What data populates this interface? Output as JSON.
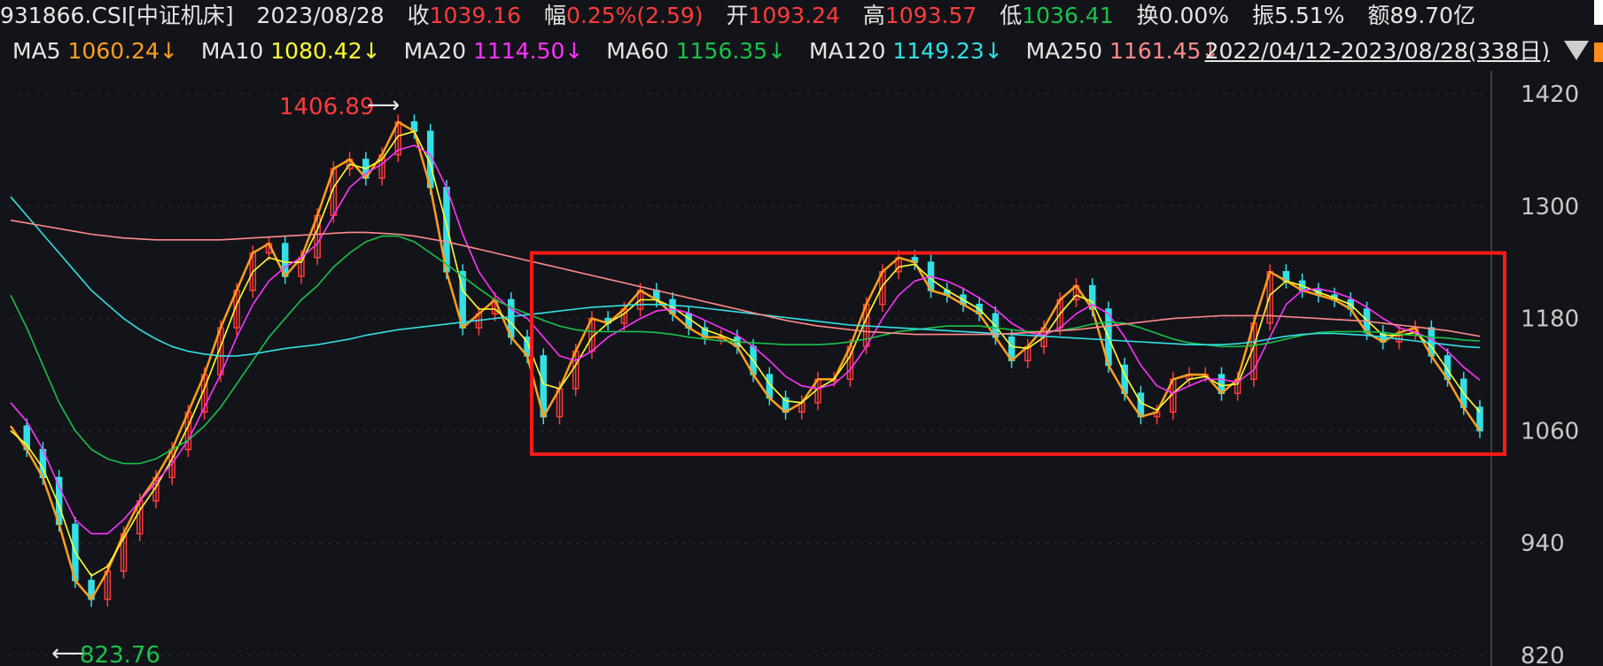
{
  "header": {
    "code": "931866.CSI[中证机床]",
    "date": "2023/08/28",
    "close_label": "收",
    "close_value": "1039.16",
    "change_label": "幅",
    "change_value": "0.25%(2.59)",
    "open_label": "开",
    "open_value": "1093.24",
    "high_label": "高",
    "high_value": "1093.57",
    "low_label": "低",
    "low_value": "1036.41",
    "turnover_label": "换",
    "turnover_value": "0.00%",
    "amplitude_label": "振",
    "amplitude_value": "5.51%",
    "amount_label": "额",
    "amount_value": "89.70亿"
  },
  "ma_row": {
    "ma5_label": "MA5",
    "ma5_value": "1060.24↓",
    "ma10_label": "MA10",
    "ma10_value": "1080.42↓",
    "ma20_label": "MA20",
    "ma20_value": "1114.50↓",
    "ma60_label": "MA60",
    "ma60_value": "1156.35↓",
    "ma120_label": "MA120",
    "ma120_value": "1149.23↓",
    "ma250_label": "MA250",
    "ma250_value": "1161.45↓",
    "range": "2022/04/12-2023/08/28(338日)"
  },
  "colors": {
    "background": "#131419",
    "ma5": "#ff9f1c",
    "ma10": "#ffff33",
    "ma20": "#ff33ff",
    "ma60": "#19c24b",
    "ma120": "#33e0e6",
    "ma250": "#ff8a8a",
    "up": "#ff3b3b",
    "down": "#33e0e6",
    "box": "#ff1a1a",
    "grid": "#2a2d35"
  },
  "chart_data": {
    "type": "line",
    "title": "",
    "xlabel": "",
    "ylabel": "",
    "ylim": [
      820,
      1440
    ],
    "yticks": [
      "1420",
      "1300",
      "1180",
      "1060",
      "940",
      "820"
    ],
    "annotations": {
      "high_label": "1406.89",
      "low_label": "823.76"
    },
    "highlight_box": {
      "y_top": 1250,
      "y_bottom": 1035
    },
    "series": [
      {
        "name": "MA5",
        "values": [
          1065,
          1040,
          1010,
          960,
          900,
          880,
          910,
          950,
          985,
          1010,
          1040,
          1080,
          1120,
          1170,
          1210,
          1250,
          1260,
          1225,
          1245,
          1290,
          1340,
          1350,
          1330,
          1355,
          1390,
          1380,
          1320,
          1230,
          1170,
          1185,
          1200,
          1160,
          1140,
          1075,
          1105,
          1145,
          1180,
          1175,
          1190,
          1210,
          1200,
          1185,
          1170,
          1160,
          1160,
          1150,
          1120,
          1095,
          1080,
          1090,
          1115,
          1115,
          1150,
          1195,
          1230,
          1245,
          1240,
          1210,
          1205,
          1195,
          1185,
          1160,
          1135,
          1150,
          1170,
          1200,
          1215,
          1190,
          1130,
          1100,
          1075,
          1080,
          1115,
          1120,
          1120,
          1100,
          1115,
          1175,
          1230,
          1220,
          1210,
          1205,
          1200,
          1190,
          1165,
          1155,
          1165,
          1170,
          1140,
          1115,
          1085,
          1060
        ]
      },
      {
        "name": "MA10",
        "values": [
          1060,
          1045,
          1020,
          980,
          930,
          905,
          915,
          945,
          975,
          1000,
          1030,
          1065,
          1105,
          1150,
          1195,
          1230,
          1245,
          1240,
          1240,
          1275,
          1320,
          1345,
          1340,
          1350,
          1375,
          1380,
          1345,
          1280,
          1210,
          1190,
          1190,
          1175,
          1155,
          1110,
          1105,
          1130,
          1160,
          1175,
          1185,
          1200,
          1200,
          1192,
          1180,
          1168,
          1162,
          1155,
          1135,
          1110,
          1092,
          1090,
          1105,
          1115,
          1140,
          1180,
          1215,
          1235,
          1238,
          1222,
          1210,
          1200,
          1190,
          1172,
          1150,
          1148,
          1160,
          1185,
          1205,
          1198,
          1160,
          1120,
          1090,
          1082,
          1100,
          1115,
          1118,
          1108,
          1110,
          1150,
          1205,
          1220,
          1215,
          1208,
          1202,
          1195,
          1178,
          1162,
          1162,
          1165,
          1150,
          1125,
          1100,
          1080
        ]
      },
      {
        "name": "MA20",
        "values": [
          1090,
          1070,
          1040,
          1000,
          965,
          950,
          950,
          965,
          985,
          1005,
          1025,
          1050,
          1085,
          1120,
          1160,
          1195,
          1220,
          1235,
          1245,
          1260,
          1290,
          1320,
          1335,
          1345,
          1360,
          1365,
          1355,
          1320,
          1270,
          1230,
          1205,
          1190,
          1180,
          1160,
          1140,
          1135,
          1145,
          1160,
          1170,
          1180,
          1188,
          1190,
          1186,
          1178,
          1170,
          1162,
          1150,
          1135,
          1118,
          1108,
          1105,
          1110,
          1125,
          1150,
          1180,
          1205,
          1220,
          1225,
          1220,
          1212,
          1202,
          1190,
          1175,
          1165,
          1162,
          1170,
          1185,
          1195,
          1185,
          1160,
          1130,
          1108,
          1100,
          1108,
          1115,
          1115,
          1112,
          1125,
          1160,
          1195,
          1210,
          1212,
          1208,
          1202,
          1192,
          1180,
          1170,
          1165,
          1158,
          1145,
          1128,
          1114
        ]
      },
      {
        "name": "MA60",
        "values": [
          1205,
          1170,
          1130,
          1090,
          1060,
          1040,
          1030,
          1025,
          1025,
          1030,
          1040,
          1050,
          1065,
          1085,
          1110,
          1135,
          1160,
          1180,
          1200,
          1215,
          1235,
          1250,
          1262,
          1268,
          1268,
          1262,
          1250,
          1238,
          1225,
          1212,
          1200,
          1192,
          1185,
          1178,
          1172,
          1168,
          1166,
          1166,
          1166,
          1166,
          1165,
          1163,
          1160,
          1158,
          1156,
          1155,
          1154,
          1153,
          1152,
          1152,
          1152,
          1153,
          1155,
          1158,
          1162,
          1166,
          1168,
          1170,
          1172,
          1172,
          1172,
          1170,
          1168,
          1166,
          1166,
          1167,
          1170,
          1174,
          1176,
          1175,
          1170,
          1164,
          1158,
          1154,
          1152,
          1150,
          1150,
          1151,
          1154,
          1158,
          1162,
          1165,
          1166,
          1166,
          1166,
          1165,
          1163,
          1162,
          1160,
          1159,
          1157,
          1156
        ]
      },
      {
        "name": "MA120",
        "values": [
          1310,
          1290,
          1270,
          1250,
          1230,
          1210,
          1195,
          1180,
          1168,
          1158,
          1150,
          1145,
          1142,
          1140,
          1140,
          1142,
          1145,
          1148,
          1150,
          1152,
          1155,
          1158,
          1162,
          1165,
          1168,
          1170,
          1172,
          1174,
          1176,
          1178,
          1180,
          1182,
          1184,
          1186,
          1188,
          1190,
          1192,
          1193,
          1194,
          1195,
          1195,
          1194,
          1193,
          1191,
          1189,
          1187,
          1185,
          1183,
          1181,
          1179,
          1177,
          1175,
          1173,
          1172,
          1171,
          1170,
          1169,
          1168,
          1167,
          1166,
          1165,
          1164,
          1163,
          1162,
          1161,
          1160,
          1159,
          1158,
          1157,
          1156,
          1155,
          1154,
          1153,
          1152,
          1152,
          1152,
          1153,
          1155,
          1158,
          1161,
          1163,
          1164,
          1164,
          1163,
          1162,
          1160,
          1158,
          1156,
          1154,
          1152,
          1150,
          1149
        ]
      },
      {
        "name": "MA250",
        "values": [
          1285,
          1282,
          1279,
          1276,
          1273,
          1270,
          1268,
          1266,
          1265,
          1264,
          1264,
          1264,
          1264,
          1264,
          1265,
          1266,
          1267,
          1268,
          1269,
          1270,
          1271,
          1272,
          1272,
          1271,
          1270,
          1268,
          1265,
          1262,
          1258,
          1254,
          1250,
          1246,
          1242,
          1238,
          1234,
          1230,
          1226,
          1222,
          1218,
          1214,
          1210,
          1206,
          1202,
          1198,
          1194,
          1190,
          1186,
          1182,
          1178,
          1175,
          1172,
          1170,
          1168,
          1166,
          1165,
          1164,
          1163,
          1163,
          1163,
          1163,
          1163,
          1163,
          1164,
          1165,
          1166,
          1167,
          1168,
          1170,
          1172,
          1174,
          1176,
          1178,
          1180,
          1181,
          1182,
          1183,
          1183,
          1183,
          1183,
          1182,
          1181,
          1180,
          1179,
          1178,
          1177,
          1175,
          1173,
          1171,
          1169,
          1167,
          1164,
          1161
        ]
      }
    ]
  }
}
